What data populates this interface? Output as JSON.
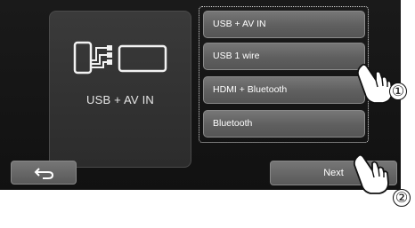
{
  "device_panel": {
    "label": "USB + AV IN",
    "icon": "phone-usb-display-icon"
  },
  "options": [
    {
      "label": "USB + AV IN"
    },
    {
      "label": "USB 1 wire"
    },
    {
      "label": "HDMI + Bluetooth"
    },
    {
      "label": "Bluetooth"
    }
  ],
  "navigation": {
    "back_icon": "back-arrow-icon",
    "next_label": "Next"
  },
  "callouts": {
    "step1": "①",
    "step2": "②"
  },
  "colors": {
    "screen_bg": "#111111",
    "button_face": "#666666",
    "text": "#ffffff"
  }
}
